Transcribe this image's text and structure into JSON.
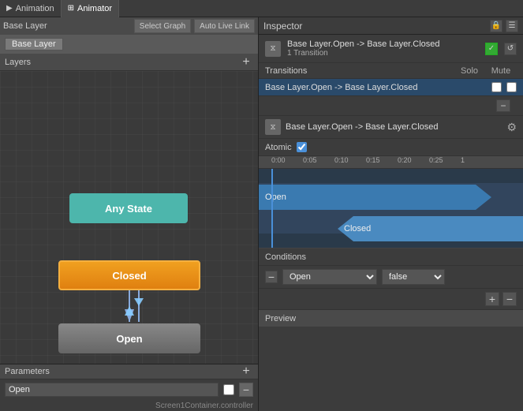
{
  "tabs": [
    {
      "id": "animation",
      "label": "Animation",
      "active": false
    },
    {
      "id": "animator",
      "label": "Animator",
      "active": true
    }
  ],
  "left": {
    "toolbar": {
      "title": "Base Layer",
      "select_graph_btn": "Select Graph",
      "auto_live_link_btn": "Auto Live Link"
    },
    "breadcrumb": "Base Layer",
    "layers": {
      "label": "Layers",
      "add_btn": "+"
    },
    "nodes": {
      "any_state": "Any State",
      "closed": "Closed",
      "open": "Open"
    },
    "params": {
      "label": "Parameters",
      "add_btn": "+",
      "items": [
        {
          "name": "Open",
          "type": "bool"
        }
      ]
    },
    "file_label": "Screen1Container.controller"
  },
  "inspector": {
    "title": "Inspector",
    "transition_title": "Base Layer.Open -> Base Layer.Closed",
    "transition_count": "1 Transition",
    "transitions_label": "Transitions",
    "solo_label": "Solo",
    "mute_label": "Mute",
    "transition_row": "Base Layer.Open -> Base Layer.Closed",
    "second_transition": "Base Layer.Open -> Base Layer.Closed",
    "atomic_label": "Atomic",
    "atomic_checked": true,
    "ruler_marks": [
      "0:00",
      "0:05",
      "0:10",
      "0:15",
      "0:20",
      "0:25"
    ],
    "bar_open_label": "Open",
    "bar_closed_label": "Closed",
    "conditions_label": "Conditions",
    "condition": {
      "param": "Open",
      "value": "false"
    },
    "preview_label": "Preview"
  }
}
